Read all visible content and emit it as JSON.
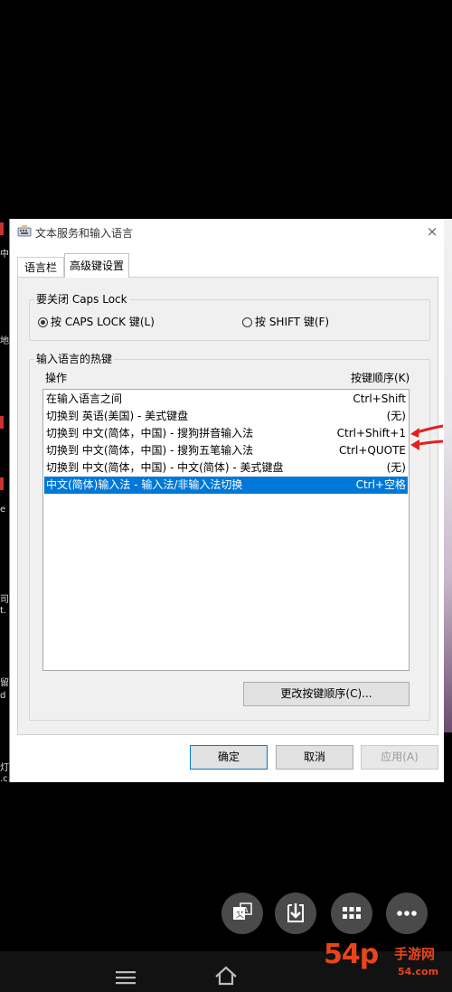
{
  "background_slivers": [
    "中",
    "地",
    "e",
    "司",
    "t.",
    "留",
    "d",
    "灯",
    ".c..."
  ],
  "dialog": {
    "title": "文本服务和输入语言",
    "close_glyph": "×",
    "tabs": [
      {
        "label": "语言栏",
        "active": false
      },
      {
        "label": "高级键设置",
        "active": true
      }
    ],
    "caps_group": {
      "label": "要关闭 Caps Lock",
      "options": [
        {
          "label": "按 CAPS LOCK 键(L)",
          "selected": true
        },
        {
          "label": "按 SHIFT 键(F)",
          "selected": false
        }
      ]
    },
    "hotkeys_group": {
      "label": "输入语言的热键",
      "col_action": "操作",
      "col_sequence": "按键顺序(K)",
      "rows": [
        {
          "name": "在输入语言之间",
          "keys": "Ctrl+Shift",
          "selected": false
        },
        {
          "name": "切换到 英语(美国) - 美式键盘",
          "keys": "(无)",
          "selected": false
        },
        {
          "name": "切换到 中文(简体，中国) - 搜狗拼音输入法",
          "keys": "Ctrl+Shift+1",
          "selected": false
        },
        {
          "name": "切换到 中文(简体，中国) - 搜狗五笔输入法",
          "keys": "Ctrl+QUOTE",
          "selected": false
        },
        {
          "name": "切换到 中文(简体，中国) - 中文(简体) - 美式键盘",
          "keys": "(无)",
          "selected": false
        },
        {
          "name": "中文(简体)输入法 - 输入法/非输入法切换",
          "keys": "Ctrl+空格",
          "selected": true
        }
      ],
      "change_button": "更改按键顺序(C)..."
    },
    "buttons": {
      "ok": "确定",
      "cancel": "取消",
      "apply": "应用(A)"
    }
  },
  "overlay_buttons": [
    "translate-icon",
    "download-icon",
    "grid-icon",
    "more-icon"
  ],
  "nav_icons": [
    "menu-icon",
    "home-icon"
  ],
  "watermark": {
    "main": "54p",
    "site": "手游网",
    "url": "54.com"
  },
  "colors": {
    "selection": "#0078d7",
    "arrow": "#e02020",
    "watermark": "#e8451c"
  }
}
